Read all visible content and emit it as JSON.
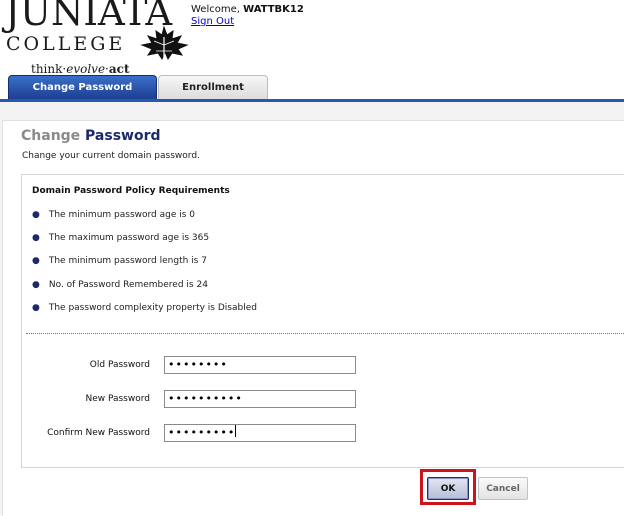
{
  "header": {
    "logo_name": "JUNIATA",
    "logo_college": "COLLEGE",
    "tagline_think": "think",
    "tagline_evolve": "evolve",
    "tagline_act": "act",
    "welcome_prefix": "Welcome,",
    "username": "WATTBK12",
    "signout_label": "Sign Out"
  },
  "tabs": [
    {
      "label": "Change Password",
      "active": true
    },
    {
      "label": "Enrollment",
      "active": false
    }
  ],
  "page": {
    "title_part1": "Change",
    "title_part2": "Password",
    "subtitle": "Change your current domain password."
  },
  "policy": {
    "heading": "Domain Password Policy Requirements",
    "items": [
      "The minimum password age is 0",
      "The maximum password age is 365",
      "The minimum password length is 7",
      "No. of Password Remembered is 24",
      "The password complexity property is Disabled"
    ]
  },
  "form": {
    "old_password_label": "Old Password",
    "old_password_value": "••••••••",
    "new_password_label": "New Password",
    "new_password_value": "••••••••••",
    "confirm_password_label": "Confirm New Password",
    "confirm_password_value": "•••••••••"
  },
  "buttons": {
    "ok_label": "OK",
    "cancel_label": "Cancel"
  },
  "colors": {
    "accent": "#1b2a6b",
    "tab_active": "#2b57ad",
    "highlight": "#d0121c"
  }
}
